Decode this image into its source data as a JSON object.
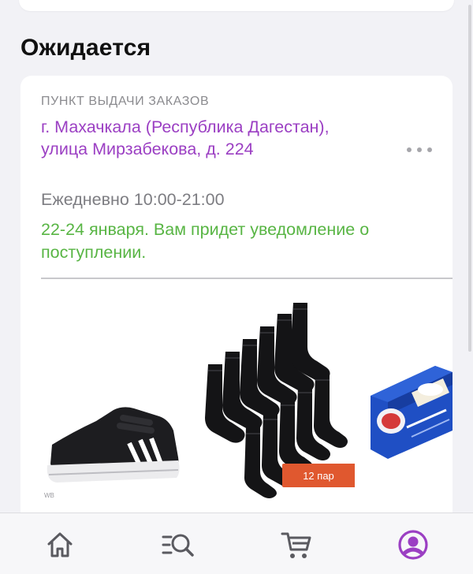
{
  "section": {
    "title": "Ожидается"
  },
  "order": {
    "pickup_label": "ПУНКТ ВЫДАЧИ ЗАКАЗОВ",
    "address": "г. Махачкала (Республика Дагестан), улица Мирзабекова, д. 224",
    "hours": "Ежедневно 10:00-21:00",
    "delivery_note": "22-24 января. Вам придет уведомление о поступлении.",
    "more_icon": "more-horizontal-icon",
    "products": [
      {
        "name_icon": "sneakers-image",
        "brand_mark": "WB"
      },
      {
        "name_icon": "socks-pack-image",
        "badge": "12 пар"
      },
      {
        "name_icon": "candy-box-image"
      }
    ]
  },
  "colors": {
    "accent": "#9b3fc3",
    "success": "#58b544",
    "muted": "#8b8b8f",
    "badge": "#e0582f",
    "tab_icon": "#5a5a60"
  },
  "tabbar": {
    "items": [
      {
        "icon": "home-icon",
        "active": false
      },
      {
        "icon": "catalog-search-icon",
        "active": false
      },
      {
        "icon": "cart-icon",
        "active": false
      },
      {
        "icon": "profile-icon",
        "active": true
      }
    ]
  }
}
